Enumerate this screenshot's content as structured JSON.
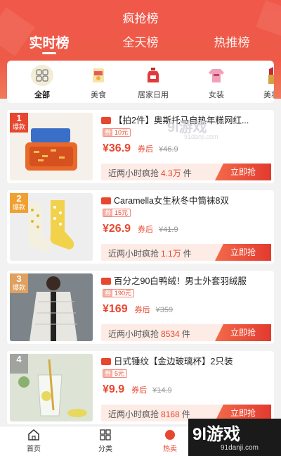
{
  "header": {
    "title": "疯抢榜"
  },
  "tabs": [
    {
      "label": "实时榜",
      "active": true
    },
    {
      "label": "全天榜",
      "active": false
    },
    {
      "label": "热推榜",
      "active": false
    }
  ],
  "categories": [
    {
      "label": "全部",
      "icon": "grid-icon",
      "active": true
    },
    {
      "label": "美食",
      "icon": "food-icon",
      "active": false
    },
    {
      "label": "居家日用",
      "icon": "detergent-icon",
      "active": false
    },
    {
      "label": "女装",
      "icon": "sweater-icon",
      "active": false
    },
    {
      "label": "美妆",
      "icon": "lipstick-icon",
      "active": false
    }
  ],
  "products": [
    {
      "rank": "1",
      "rank_tag": "爆款",
      "title": "【拍2件】奥斯托马自热年糕网红...",
      "coupon_label": "券",
      "coupon": "10元",
      "price": "¥36.9",
      "after_label": "券后",
      "old_price": "¥46.9",
      "sales_prefix": "近两小时疯抢",
      "sales": "4.3万",
      "sales_suffix": "件",
      "buy_label": "立即抢"
    },
    {
      "rank": "2",
      "rank_tag": "爆款",
      "title": "Caramella女生秋冬中筒袜8双",
      "coupon_label": "券",
      "coupon": "15元",
      "price": "¥26.9",
      "after_label": "券后",
      "old_price": "¥41.9",
      "sales_prefix": "近两小时疯抢",
      "sales": "1.1万",
      "sales_suffix": "件",
      "buy_label": "立即抢"
    },
    {
      "rank": "3",
      "rank_tag": "爆款",
      "title": "百分之90白鸭绒！男士外套羽绒服",
      "coupon_label": "券",
      "coupon": "190元",
      "price": "¥169",
      "after_label": "券后",
      "old_price": "¥359",
      "sales_prefix": "近两小时疯抢",
      "sales": "8534",
      "sales_suffix": "件",
      "buy_label": "立即抢"
    },
    {
      "rank": "4",
      "rank_tag": "",
      "title": "日式锤纹【金边玻璃杯】2只装",
      "coupon_label": "券",
      "coupon": "5元",
      "price": "¥9.9",
      "after_label": "券后",
      "old_price": "¥14.9",
      "sales_prefix": "近两小时疯抢",
      "sales": "8168",
      "sales_suffix": "件",
      "buy_label": "立即抢"
    }
  ],
  "bottom_nav": [
    {
      "label": "首页",
      "icon": "home-icon"
    },
    {
      "label": "分类",
      "icon": "category-icon"
    },
    {
      "label": "热卖",
      "icon": "fire-icon"
    }
  ],
  "watermark": {
    "big": "9l游戏",
    "small": "91danji.com",
    "float_big": "9l游戏",
    "float_small": "91danji.com"
  },
  "colors": {
    "brand": "#e8472f",
    "header": "#f0584a"
  }
}
